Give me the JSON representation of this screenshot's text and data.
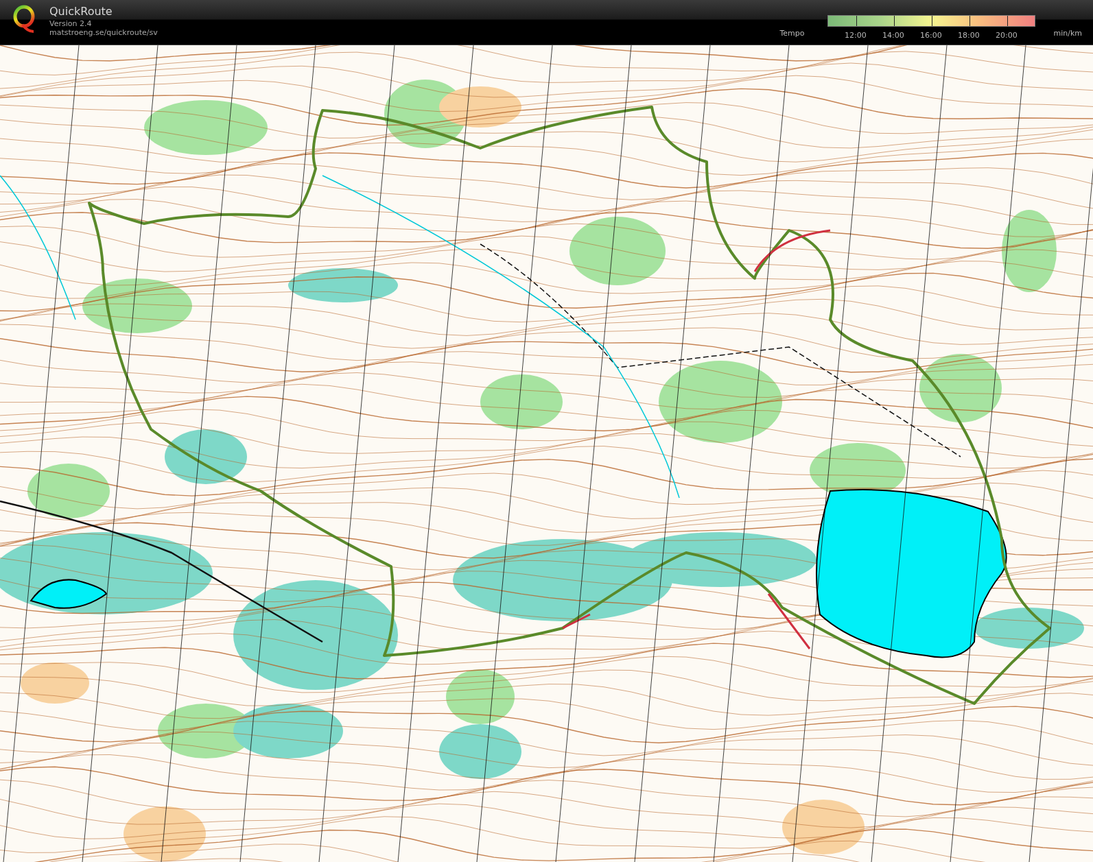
{
  "app": {
    "name": "QuickRoute",
    "version": "Version 2.4",
    "url": "matstroeng.se/quickroute/sv"
  },
  "legend": {
    "title": "Tempo",
    "ticks": [
      "12:00",
      "14:00",
      "16:00",
      "18:00",
      "20:00"
    ],
    "unit": "min/km"
  }
}
